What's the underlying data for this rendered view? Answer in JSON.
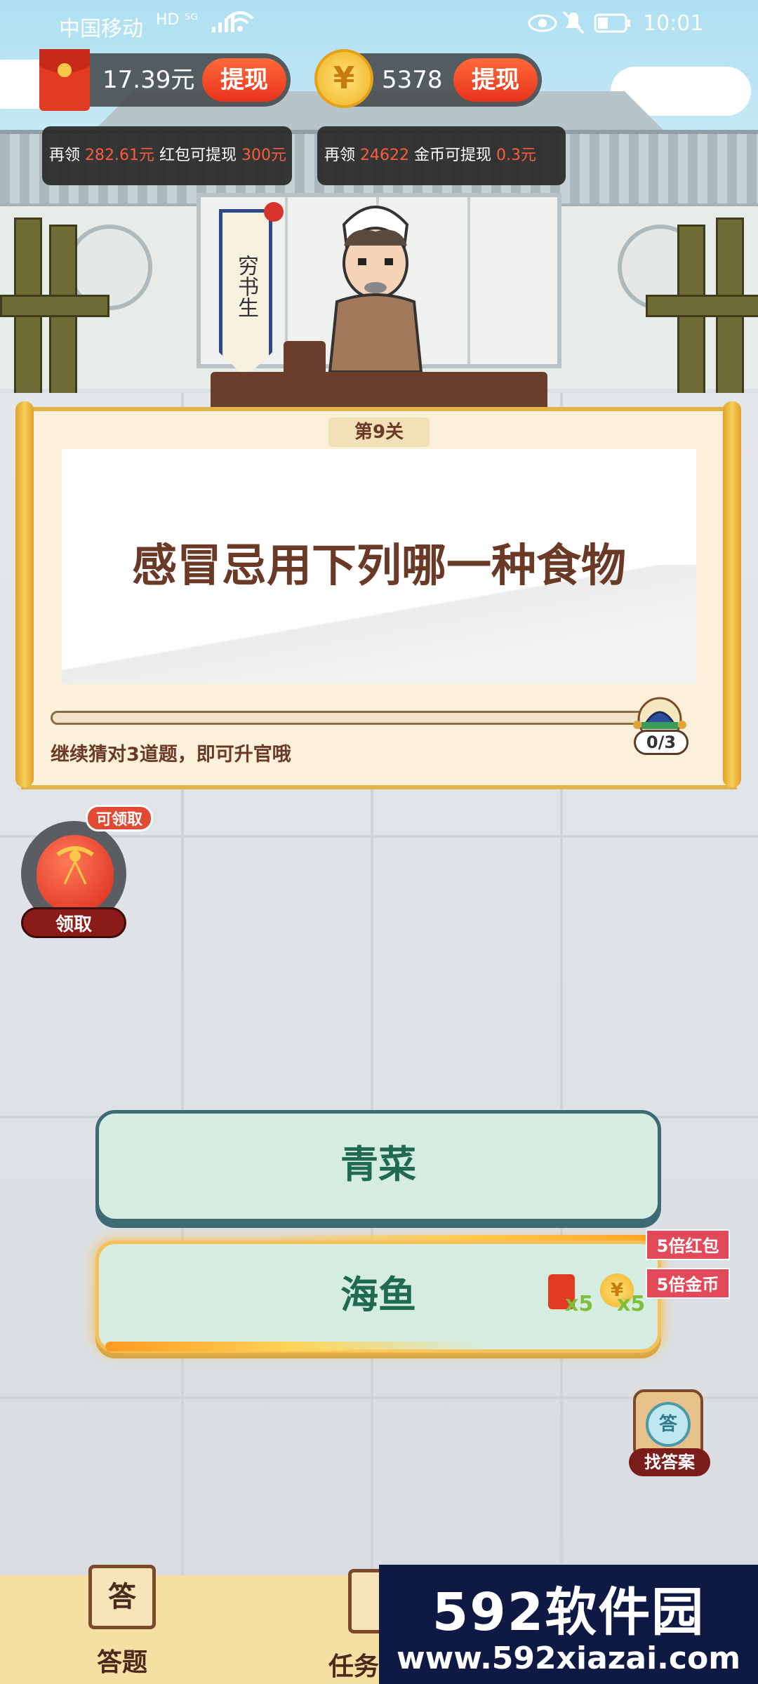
{
  "status_bar": {
    "carrier": "中国移动",
    "network_badges": "HD ⁵ᴳ",
    "time": "10:01"
  },
  "wallet": {
    "cash_amount": "17.39元",
    "cash_withdraw": "提现",
    "coin_icon": "¥",
    "coin_amount": "5378",
    "coin_withdraw": "提现",
    "cash_tip": {
      "prefix": "再领",
      "amount": "282.61元",
      "middle": "红包可提现",
      "target": "300元"
    },
    "coin_tip": {
      "prefix": "再领",
      "amount": "24622",
      "middle": "金币可提现",
      "target": "0.3元"
    }
  },
  "character": {
    "title": "穷书生"
  },
  "question_card": {
    "level": "第9关",
    "question": "感冒忌用下列哪一种食物",
    "progress_fraction": 0,
    "progress_counter": "0/3",
    "hint": "继续猜对3道题，即可升官哦"
  },
  "lucky_bag": {
    "tag": "可领取",
    "button": "领取"
  },
  "answers": [
    {
      "label": "青菜"
    },
    {
      "label": "海鱼",
      "bonus_red": "x5",
      "bonus_coin": "x5"
    }
  ],
  "multipliers": {
    "red": "5倍红包",
    "coin": "5倍金币"
  },
  "find_answer": {
    "icon_glyph": "答",
    "label": "找答案"
  },
  "bottom_nav": {
    "answer_icon_glyph": "答",
    "answer_label": "答题",
    "task_label": "任务"
  },
  "watermark": {
    "title": "592软件园",
    "url": "www.592xiazai.com"
  }
}
